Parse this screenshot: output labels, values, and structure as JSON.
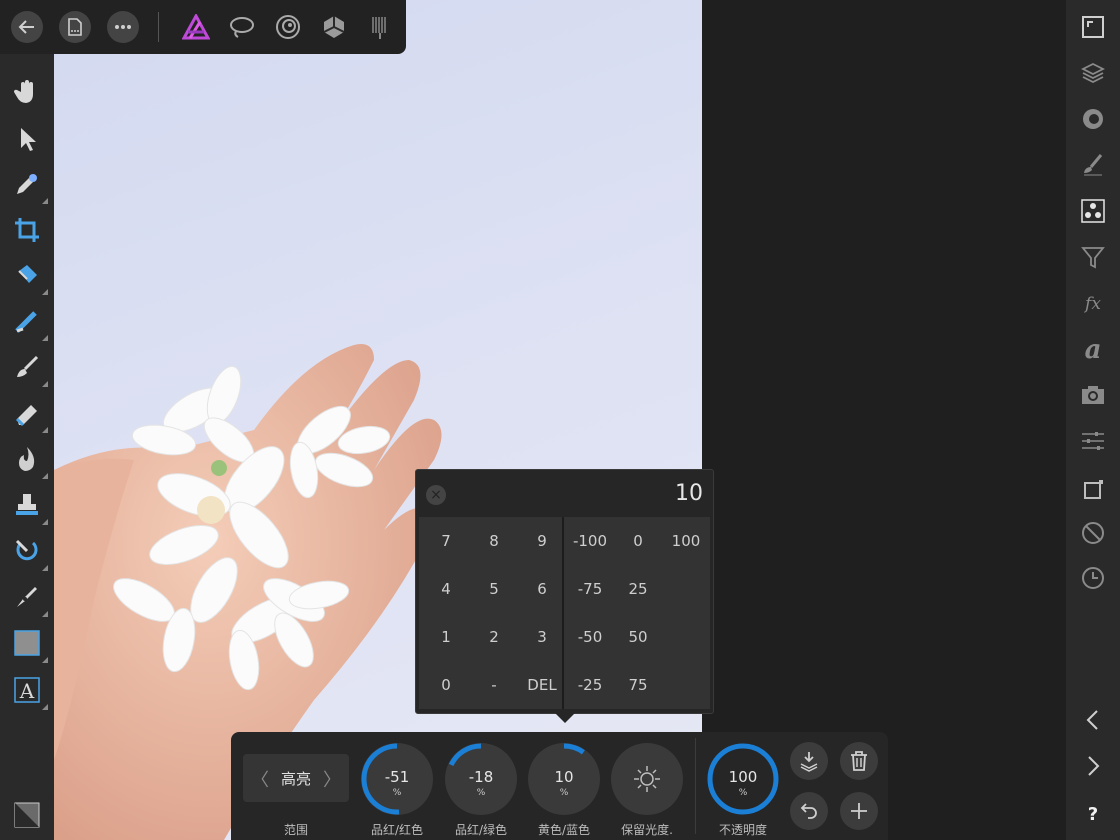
{
  "topbar": {
    "buttons": [
      "back-arrow-icon",
      "document-icon",
      "more-icon"
    ],
    "personas": [
      "photo-persona-icon",
      "liquify-persona-icon",
      "develop-persona-icon",
      "tone-mapping-persona-icon",
      "export-persona-icon"
    ]
  },
  "left_toolbar": {
    "tools": [
      "hand-icon",
      "move-icon",
      "color-picker-icon",
      "crop-icon",
      "flood-fill-icon",
      "selection-brush-icon",
      "paint-brush-icon",
      "eraser-icon",
      "burn-icon",
      "clone-icon",
      "inpainting-icon",
      "pen-icon",
      "rectangle-icon",
      "text-icon",
      "color-swatch-icon"
    ]
  },
  "right_toolbar": {
    "items": [
      "navigator-icon",
      "layers-icon",
      "channels-icon",
      "brushes-icon",
      "adjustments-icon",
      "filters-icon",
      "fx-icon",
      "text-styles-icon",
      "snapshot-icon",
      "properties-icon",
      "transform-icon",
      "history-block-icon",
      "history-icon",
      "collapse-left-icon",
      "collapse-right-icon",
      "help-icon"
    ]
  },
  "keypad": {
    "value": "10",
    "digits": [
      "7",
      "8",
      "9",
      "4",
      "5",
      "6",
      "1",
      "2",
      "3",
      "0",
      "-",
      "DEL"
    ],
    "presets": [
      "-100",
      "0",
      "100",
      "-75",
      "25",
      "-50",
      "50",
      "-25",
      "75"
    ]
  },
  "context": {
    "range": {
      "value": "高亮",
      "label": "范围"
    },
    "knobs": [
      {
        "value": "-51",
        "unit": "%",
        "label": "品红/红色",
        "fill": -0.51
      },
      {
        "value": "-18",
        "unit": "%",
        "label": "品红/绿色",
        "fill": -0.18
      },
      {
        "value": "10",
        "unit": "%",
        "label": "黄色/蓝色",
        "fill": 0.1
      }
    ],
    "preserve": {
      "label": "保留光度."
    },
    "opacity": {
      "value": "100",
      "unit": "%",
      "label": "不透明度",
      "fill": 1.0
    }
  },
  "colors": {
    "accent": "#1b7fd6",
    "panel": "#262627"
  }
}
